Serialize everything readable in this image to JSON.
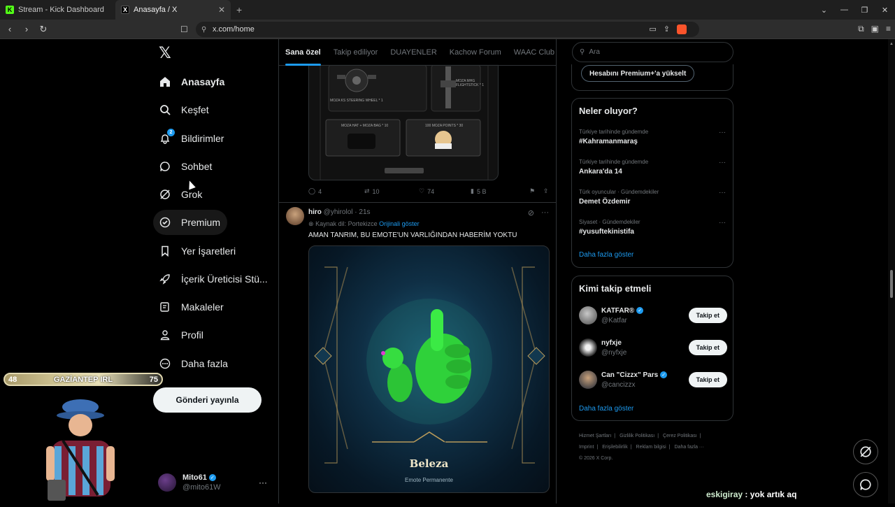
{
  "browser": {
    "tabs": [
      {
        "label": "Stream - Kick Dashboard",
        "icon": "kick-icon",
        "active": false
      },
      {
        "label": "Anasayfa / X",
        "icon": "x-icon",
        "active": true
      }
    ],
    "url": "x.com/home"
  },
  "nav": {
    "items": [
      {
        "label": "Anasayfa",
        "icon": "home-icon"
      },
      {
        "label": "Keşfet",
        "icon": "search-icon"
      },
      {
        "label": "Bildirimler",
        "icon": "bell-icon",
        "badge": "2"
      },
      {
        "label": "Sohbet",
        "icon": "chat-icon"
      },
      {
        "label": "Grok",
        "icon": "grok-icon"
      },
      {
        "label": "Premium",
        "icon": "premium-icon"
      },
      {
        "label": "Yer İşaretleri",
        "icon": "bookmark-icon"
      },
      {
        "label": "İçerik Üreticisi Stü...",
        "icon": "rocket-icon"
      },
      {
        "label": "Makaleler",
        "icon": "article-icon"
      },
      {
        "label": "Profil",
        "icon": "person-icon"
      },
      {
        "label": "Daha fazla",
        "icon": "more-circle-icon"
      }
    ],
    "post_button": "Gönderi yayınla",
    "account": {
      "name": "Mito61",
      "handle": "@mito61W"
    }
  },
  "overlay": {
    "score_left": "48",
    "city": "GAZİANTEP IRL",
    "score_right": "75",
    "chat_user": "eskigiray",
    "chat_message": " : yok artık aq"
  },
  "feed": {
    "tabs": [
      "Sana özel",
      "Takip ediliyor",
      "DUAYENLER",
      "Kachow Forum",
      "WAAC Club"
    ],
    "prev_tweet": {
      "media_labels": [
        "MOZA KS STEERING WHEEL * 1",
        "MOZA MHG FLIGHTSTICK * 1",
        "MOZA HAT + MOZA BAG * 10",
        "100 MOZA POINTS * 30"
      ],
      "replies": "4",
      "reposts": "10",
      "likes": "74",
      "views": "5 B"
    },
    "tweet": {
      "name": "hiro",
      "handle": "@yhirolol",
      "time": "· 21s",
      "translation_prefix": "Kaynak dil: Portekizce",
      "translation_link": "Orijinali göster",
      "text": "AMAN TANRIM, BU EMOTE'UN VARLIĞINDAN HABERİM YOKTU",
      "emote_title": "Beleza",
      "emote_subtitle": "Emote Permanente"
    }
  },
  "sidebar": {
    "search_placeholder": "Ara",
    "upgrade_label": "Hesabını Premium+'a yükselt",
    "trends_title": "Neler oluyor?",
    "trends": [
      {
        "context": "Türkiye tarihinde gündemde",
        "title": "#Kahramanmaraş"
      },
      {
        "context": "Türkiye tarihinde gündemde",
        "title": "Ankara'da 14"
      },
      {
        "context": "Türk oyuncular · Gündemdekiler",
        "title": "Demet Özdemir"
      },
      {
        "context": "Siyaset · Gündemdekiler",
        "title": "#yusuftekinistifa"
      }
    ],
    "show_more": "Daha fazla göster",
    "who_title": "Kimi takip etmeli",
    "who": [
      {
        "name": "KATFAR®",
        "handle": "@Katfar",
        "verified": true
      },
      {
        "name": "nyfxje",
        "handle": "@nyfxje",
        "verified": false
      },
      {
        "name": "Can \"Cizzx\" Pars",
        "handle": "@cancizzx",
        "verified": true
      }
    ],
    "follow_label": "Takip et",
    "footer": [
      "Hizmet Şartları",
      "Gizlilik Politikası",
      "Çerez Politikası",
      "Imprint",
      "Erişilebilirlik",
      "Reklam bilgisi",
      "Daha fazla ···",
      "© 2026 X Corp."
    ]
  }
}
